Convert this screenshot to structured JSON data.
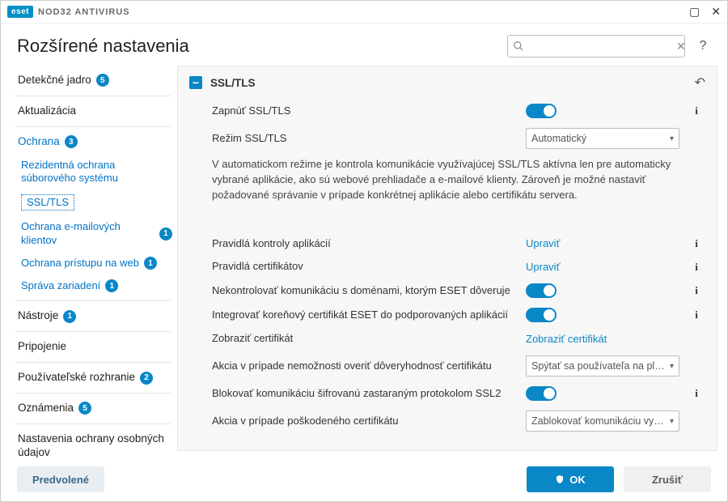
{
  "titlebar": {
    "brand": "eset",
    "product": "NOD32 ANTIVIRUS"
  },
  "header": {
    "page_title": "Rozšírené nastavenia",
    "search_placeholder": ""
  },
  "sidebar": {
    "items": [
      {
        "label": "Detekčné jadro",
        "badge": "5",
        "kind": "top"
      },
      {
        "label": "Aktualizácia",
        "kind": "top"
      },
      {
        "label": "Ochrana",
        "badge": "3",
        "kind": "top",
        "active": true
      },
      {
        "label": "Rezidentná ochrana súborového systému",
        "kind": "sub"
      },
      {
        "label": "SSL/TLS",
        "kind": "sub",
        "selected": true
      },
      {
        "label": "Ochrana e-mailových klientov",
        "badge": "1",
        "kind": "sub"
      },
      {
        "label": "Ochrana prístupu na web",
        "badge": "1",
        "kind": "sub"
      },
      {
        "label": "Správa zariadení",
        "badge": "1",
        "kind": "sub"
      },
      {
        "label": "Nástroje",
        "badge": "1",
        "kind": "top"
      },
      {
        "label": "Pripojenie",
        "kind": "top"
      },
      {
        "label": "Používateľské rozhranie",
        "badge": "2",
        "kind": "top"
      },
      {
        "label": "Oznámenia",
        "badge": "5",
        "kind": "top"
      },
      {
        "label": "Nastavenia ochrany osobných údajov",
        "kind": "top"
      }
    ]
  },
  "section": {
    "title": "SSL/TLS",
    "rows": {
      "enable": {
        "label": "Zapnúť SSL/TLS",
        "toggle": true
      },
      "mode": {
        "label": "Režim SSL/TLS",
        "select": "Automatický"
      },
      "mode_desc": "V automatickom režime je kontrola komunikácie využívajúcej SSL/TLS aktívna len pre automaticky vybrané aplikácie, ako sú webové prehliadače a e-mailové klienty. Zároveň je možné nastaviť požadované správanie v prípade konkrétnej aplikácie alebo certifikátu servera.",
      "app_rules": {
        "label": "Pravidlá kontroly aplikácií",
        "link": "Upraviť"
      },
      "cert_rules": {
        "label": "Pravidlá certifikátov",
        "link": "Upraviť"
      },
      "trusted": {
        "label": "Nekontrolovať komunikáciu s doménami, ktorým ESET dôveruje",
        "toggle": true
      },
      "integrate": {
        "label": "Integrovať koreňový certifikát ESET do podporovaných aplikácií",
        "toggle": true
      },
      "show_cert": {
        "label": "Zobraziť certifikát",
        "link": "Zobraziť certifikát"
      },
      "unverify": {
        "label": "Akcia v prípade nemožnosti overiť dôveryhodnosť certifikátu",
        "select": "Spýtať sa používateľa na pla..."
      },
      "block_ssl2": {
        "label": "Blokovať komunikáciu šifrovanú zastaraným protokolom SSL2",
        "toggle": true
      },
      "damaged": {
        "label": "Akcia v prípade poškodeného certifikátu",
        "select": "Zablokovať komunikáciu vyu..."
      }
    }
  },
  "footer": {
    "default": "Predvolené",
    "ok": "OK",
    "cancel": "Zrušiť"
  }
}
